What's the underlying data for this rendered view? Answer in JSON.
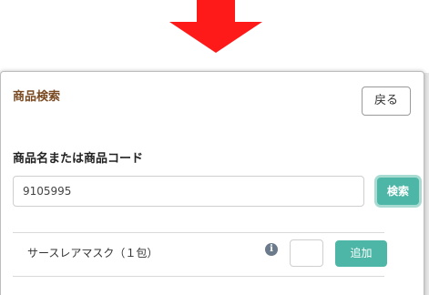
{
  "colors": {
    "arrow": "#ff1a1a",
    "title": "#7a4a22",
    "accent_button": "#4db6a6",
    "info_icon": "#6b7b8c"
  },
  "modal": {
    "title": "商品検索",
    "back_label": "戻る",
    "search_label": "商品名または商品コード",
    "search_value": "9105995",
    "search_button_label": "検索"
  },
  "results": [
    {
      "name": "サースレアマスク（１包）",
      "info_icon": "info-icon",
      "quantity_value": "",
      "add_label": "追加"
    }
  ],
  "icons": {
    "arrow": "down-arrow-icon",
    "info": "info-circle-icon"
  }
}
